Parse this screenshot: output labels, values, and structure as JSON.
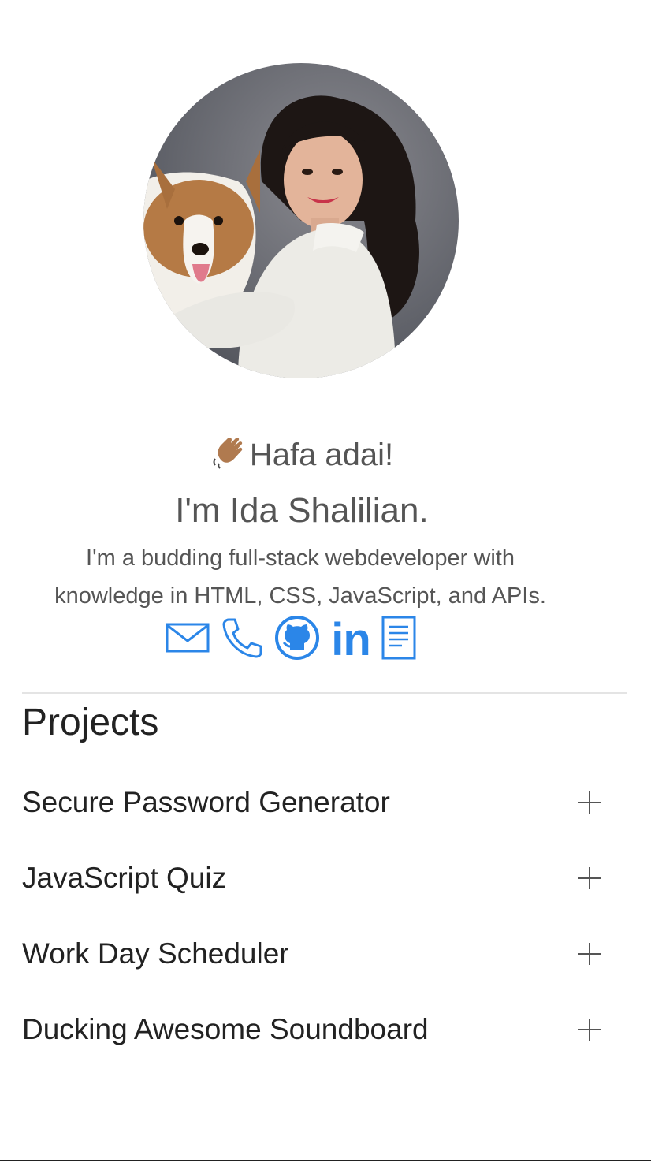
{
  "profile": {
    "photo_alt": "Ida with a corgi",
    "greeting": "Hafa adai!",
    "name_line": "I'm Ida Shalilian.",
    "bio_line1": "I'm a budding full-stack webdeveloper with",
    "bio_line2": "knowledge in HTML, CSS, JavaScript, and APIs."
  },
  "socials": {
    "accent_color": "#2b86e8",
    "items": [
      {
        "icon": "envelope-icon"
      },
      {
        "icon": "phone-icon"
      },
      {
        "icon": "github-icon"
      },
      {
        "icon": "linkedin-icon",
        "label": "in"
      },
      {
        "icon": "resume-icon"
      }
    ]
  },
  "projects": {
    "heading": "Projects",
    "items": [
      {
        "title": "Secure Password Generator"
      },
      {
        "title": "JavaScript Quiz"
      },
      {
        "title": "Work Day Scheduler"
      },
      {
        "title": "Ducking Awesome Soundboard"
      }
    ]
  }
}
